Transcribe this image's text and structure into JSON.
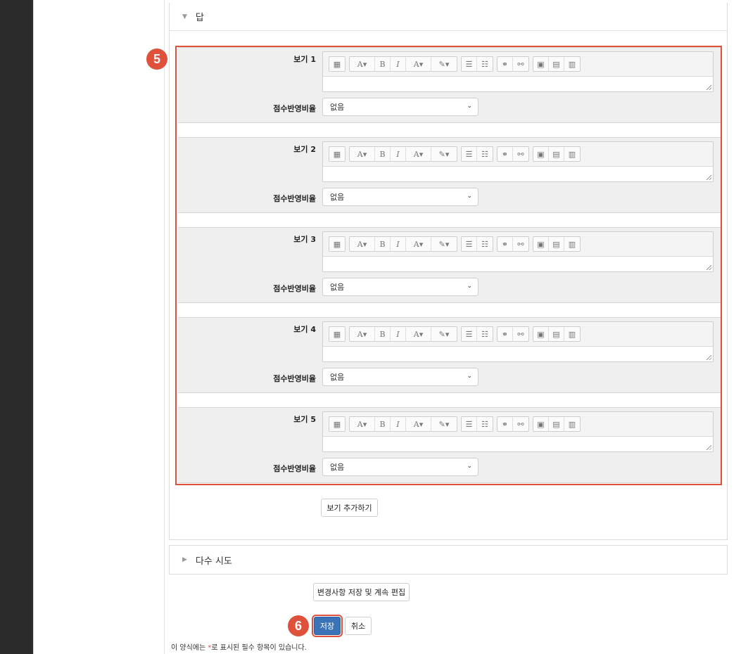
{
  "answer_section": {
    "title": "답"
  },
  "choices": [
    {
      "label": "보기 1",
      "grade_label": "점수반영비율",
      "grade_value": "없음"
    },
    {
      "label": "보기 2",
      "grade_label": "점수반영비율",
      "grade_value": "없음"
    },
    {
      "label": "보기 3",
      "grade_label": "점수반영비율",
      "grade_value": "없음"
    },
    {
      "label": "보기 4",
      "grade_label": "점수반영비율",
      "grade_value": "없음"
    },
    {
      "label": "보기 5",
      "grade_label": "점수반영비율",
      "grade_value": "없음"
    }
  ],
  "toolbar": {
    "icons": [
      "toggle-toolbar-icon",
      "font-size-icon",
      "bold-icon",
      "italic-icon",
      "font-color-icon",
      "background-color-icon",
      "unordered-list-icon",
      "ordered-list-icon",
      "link-icon",
      "unlink-icon",
      "image-icon",
      "media-icon",
      "video-icon"
    ],
    "bold_glyph": "B",
    "italic_glyph": "I"
  },
  "add_choice_label": "보기 추가하기",
  "multiple_tries": {
    "title": "다수 시도"
  },
  "save_continue_label": "변경사항 저장 및 계속 편집",
  "save_label": "저장",
  "cancel_label": "취소",
  "required_note": {
    "before": "이 양식에는 ",
    "star": "*",
    "after": "로 표시된 필수 항목이 있습니다."
  },
  "callouts": {
    "five": "5",
    "six": "6"
  },
  "colors": {
    "callout": "#e0513b",
    "primary_button": "#3a73b8",
    "sidebar": "#2b2b2b"
  }
}
